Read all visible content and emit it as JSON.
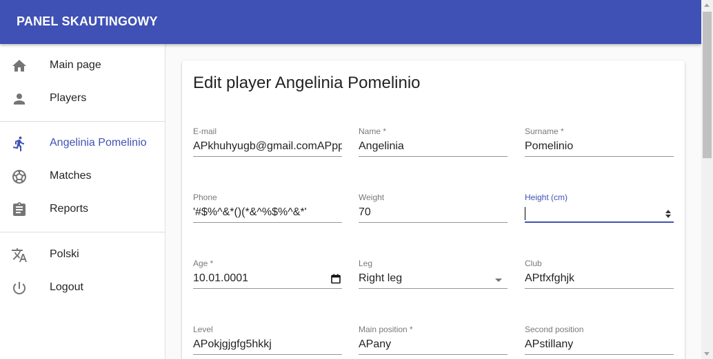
{
  "app": {
    "title": "PANEL SKAUTINGOWY"
  },
  "sidebar": {
    "items": [
      {
        "label": "Main page",
        "icon": "home-icon"
      },
      {
        "label": "Players",
        "icon": "person-icon"
      },
      {
        "label": "Angelinia Pomelinio",
        "icon": "running-person-icon",
        "active": true
      },
      {
        "label": "Matches",
        "icon": "soccer-ball-icon"
      },
      {
        "label": "Reports",
        "icon": "clipboard-icon"
      },
      {
        "label": "Polski",
        "icon": "translate-icon"
      },
      {
        "label": "Logout",
        "icon": "power-icon"
      }
    ]
  },
  "form": {
    "title": "Edit player Angelinia Pomelinio",
    "fields": {
      "email": {
        "label": "E-mail",
        "value": "APkhuhyugb@gmail.comAPpp"
      },
      "name": {
        "label": "Name *",
        "value": "Angelinia"
      },
      "surname": {
        "label": "Surname *",
        "value": "Pomelinio"
      },
      "phone": {
        "label": "Phone",
        "value": "'#$%^&*()(*&^%$%^&*'"
      },
      "weight": {
        "label": "Weight",
        "value": "70"
      },
      "height": {
        "label": "Height (cm)",
        "value": ""
      },
      "age": {
        "label": "Age *",
        "value": "10.01.0001"
      },
      "leg": {
        "label": "Leg",
        "value": "Right leg"
      },
      "club": {
        "label": "Club",
        "value": "APtfxfghjk"
      },
      "level": {
        "label": "Level",
        "value": "APokjgjgfg5hkkj"
      },
      "main_position": {
        "label": "Main position *",
        "value": "APany"
      },
      "second_position": {
        "label": "Second position",
        "value": "APstillany"
      }
    }
  },
  "colors": {
    "primary": "#3f51b5",
    "icon": "#757575"
  }
}
